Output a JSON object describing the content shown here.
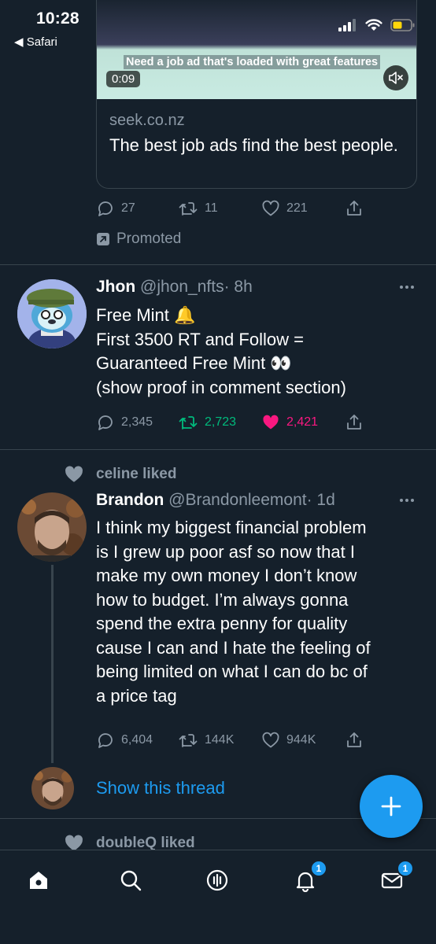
{
  "status_bar": {
    "time": "10:28",
    "back_app": "◀ Safari"
  },
  "ad": {
    "video_caption": "Need a job ad that's loaded with great features",
    "video_time": "0:09",
    "domain": "seek.co.nz",
    "title": "The best job ads find the best people.",
    "replies": "27",
    "retweets": "11",
    "likes": "221",
    "promoted_label": "Promoted"
  },
  "tweets": [
    {
      "name": "Jhon",
      "handle": "@jhon_nfts",
      "time": "· 8h",
      "lines": [
        "Free Mint 🔔",
        "First 3500 RT and Follow  =",
        "Guaranteed Free Mint 👀",
        "(show proof in comment section)"
      ],
      "replies": "2,345",
      "retweets": "2,723",
      "likes": "2,421",
      "retweet_color": "#00ba7c",
      "like_color": "#f91880"
    },
    {
      "liked_by": "celine liked",
      "name": "Brandon",
      "handle": "@Brandonleemont",
      "time": "· 1d",
      "lines": [
        "I think my biggest financial problem",
        "is I grew up poor asf so now that I",
        "make my own money I don’t know",
        "how to budget. I’m always gonna",
        "spend the extra penny for quality",
        "cause I can and I hate the feeling of",
        "being limited on what I can do bc of",
        "a price tag"
      ],
      "replies": "6,404",
      "retweets": "144K",
      "likes": "944K",
      "show_thread": "Show this thread"
    }
  ],
  "next_liked_by": "doubleQ liked",
  "tab_bar": {
    "icons": [
      "home-icon",
      "search-icon",
      "spaces-icon",
      "notifications-icon",
      "messages-icon"
    ],
    "notifications_badge": "1",
    "messages_badge": "1"
  },
  "colors": {
    "background": "#15202b",
    "accent": "#1d9bf0",
    "muted": "#8b98a5",
    "divider": "#38444d"
  }
}
